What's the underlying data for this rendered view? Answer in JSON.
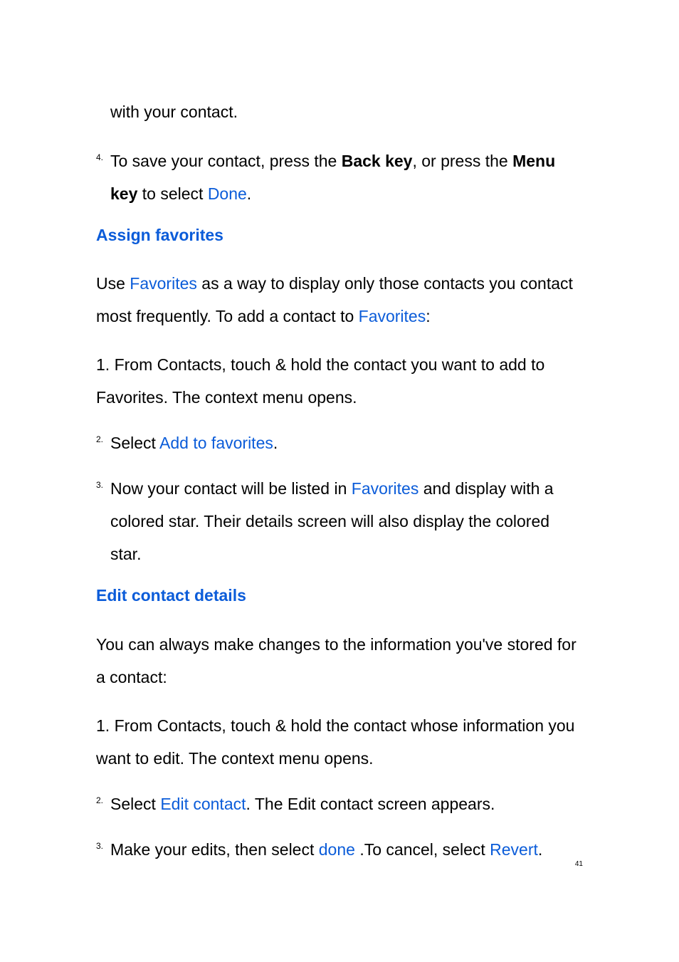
{
  "continuation": "with your contact.",
  "step4": {
    "num": "4.",
    "pre": "To save your contact, press the ",
    "bold1": "Back key",
    "mid": ", or press the ",
    "bold2": "Menu key",
    "post": " to select ",
    "blue": "Done",
    "end": "."
  },
  "section1": {
    "heading": "Assign favorites",
    "intro_pre": "Use ",
    "intro_blue1": "Favorites",
    "intro_mid": " as a way to display only those contacts you contact most frequently. To add a contact to ",
    "intro_blue2": "Favorites",
    "intro_end": ":",
    "step1": "1.  From Contacts, touch & hold the contact you want to add to Favorites. The context menu opens.",
    "step2": {
      "num": "2.",
      "pre": "Select ",
      "blue": "Add to favorites",
      "end": "."
    },
    "step3": {
      "num": "3.",
      "pre": "Now your contact will be listed in ",
      "blue": "Favorites",
      "post": " and display with a colored star. Their details screen will also display the colored star."
    }
  },
  "section2": {
    "heading": "Edit contact details",
    "intro": "You can always make changes to the information you've stored for a contact:",
    "step1": "1.  From Contacts, touch & hold the contact whose information you want to edit. The context menu opens.",
    "step2": {
      "num": "2.",
      "pre": "Select ",
      "blue": "Edit contact",
      "post": ". The Edit contact screen appears."
    },
    "step3": {
      "num": "3.",
      "pre": "Make your edits, then select ",
      "blue1": "done",
      "mid": " .To cancel, select ",
      "blue2": "Revert",
      "end": "."
    }
  },
  "page_number": "41"
}
